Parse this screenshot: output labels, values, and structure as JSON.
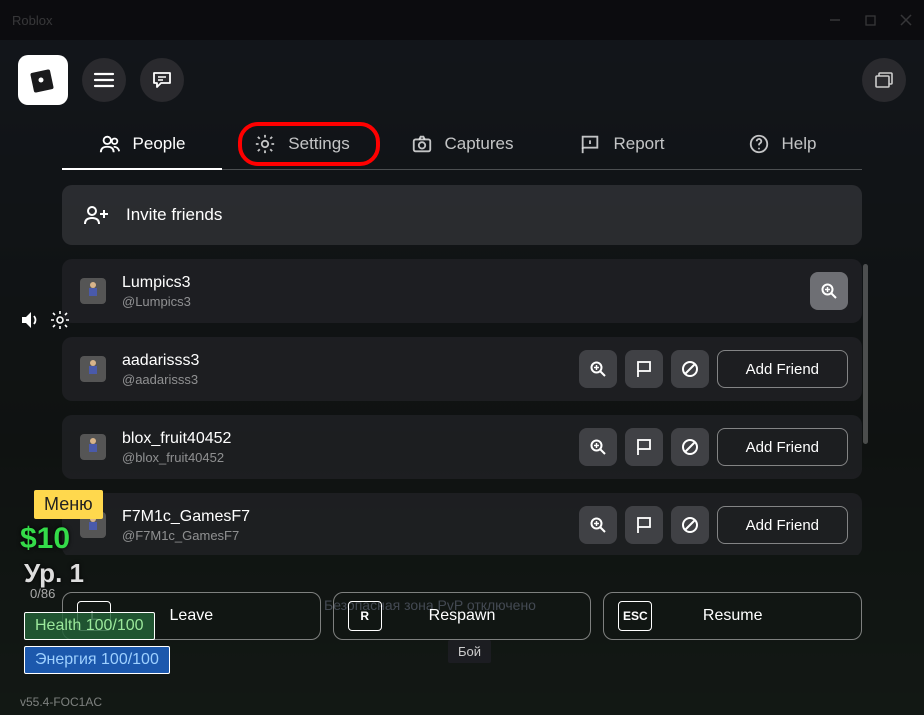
{
  "titlebar": {
    "title": "Roblox"
  },
  "tabs": [
    {
      "label": "People",
      "icon": "people-icon",
      "active": true
    },
    {
      "label": "Settings",
      "icon": "gear-icon",
      "active": false,
      "highlighted": true
    },
    {
      "label": "Captures",
      "icon": "camera-icon",
      "active": false
    },
    {
      "label": "Report",
      "icon": "flag-icon",
      "active": false
    },
    {
      "label": "Help",
      "icon": "help-icon",
      "active": false
    }
  ],
  "invite_label": "Invite friends",
  "players": [
    {
      "name": "Lumpics3",
      "handle": "@Lumpics3",
      "self": true
    },
    {
      "name": "aadarisss3",
      "handle": "@aadarisss3",
      "self": false
    },
    {
      "name": "blox_fruit40452",
      "handle": "@blox_fruit40452",
      "self": false
    },
    {
      "name": "F7M1c_GamesF7",
      "handle": "@F7M1c_GamesF7",
      "self": false
    }
  ],
  "add_friend_label": "Add Friend",
  "bottom": {
    "leave": {
      "key": "L",
      "label": "Leave"
    },
    "respawn": {
      "key": "R",
      "label": "Respawn"
    },
    "resume": {
      "key": "ESC",
      "label": "Resume"
    }
  },
  "hud": {
    "menu": "Меню",
    "money": "$10",
    "level": "Ур. 1",
    "subtext": "0/86",
    "health": "Health 100/100",
    "energy": "Энергия 100/100"
  },
  "behind_text": "Безопасная зона PvP отключено",
  "boi_label": "Бой",
  "version": "v55.4-FOC1AC"
}
